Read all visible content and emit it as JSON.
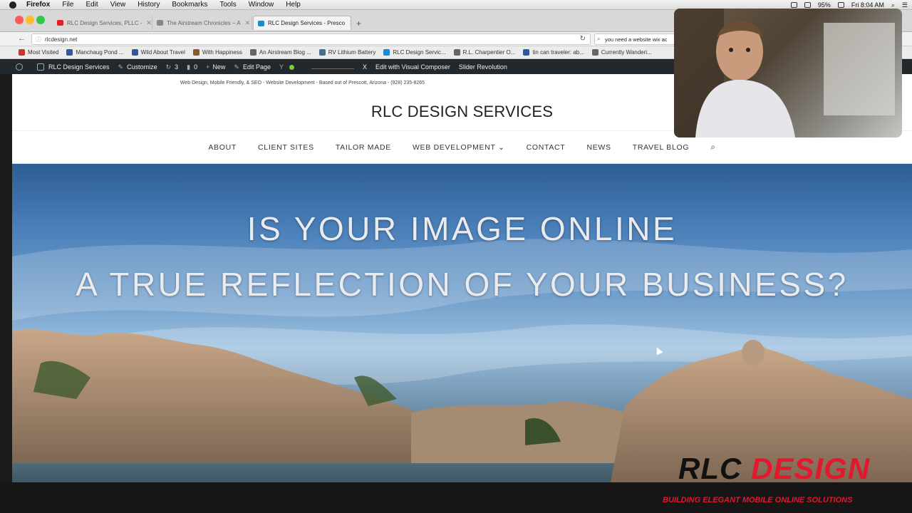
{
  "menubar": {
    "app": "Firefox",
    "items": [
      "File",
      "Edit",
      "View",
      "History",
      "Bookmarks",
      "Tools",
      "Window",
      "Help"
    ],
    "battery": "95%",
    "clock": "Fri 8:04 AM"
  },
  "tabs": [
    {
      "label": "RLC Design Services, PLLC -",
      "color": "#e02020"
    },
    {
      "label": "The Airstream Chronicles – A",
      "color": "#666666"
    },
    {
      "label": "RLC Design Services - Presco",
      "color": "#1a8ad4"
    }
  ],
  "navbar": {
    "url": "rlcdesign.net",
    "search": "you need a website wix ac"
  },
  "bookmarks": [
    {
      "label": "Most Visited",
      "color": "#c0392b"
    },
    {
      "label": "Manchaug Pond ...",
      "color": "#2c5aa0"
    },
    {
      "label": "Wild About Travel",
      "color": "#2c5aa0"
    },
    {
      "label": "With Happiness",
      "color": "#8a5a2b"
    },
    {
      "label": "An Airstream Blog ...",
      "color": "#666666"
    },
    {
      "label": "RV Lithium Battery",
      "color": "#4a6f8a"
    },
    {
      "label": "RLC Design Servic...",
      "color": "#1a8ad4"
    },
    {
      "label": "R.L. Charpentier O...",
      "color": "#666666"
    },
    {
      "label": "tin can traveler: ab...",
      "color": "#2c5aa0"
    },
    {
      "label": "Currently Wanderi...",
      "color": "#666666"
    }
  ],
  "adminbar": {
    "site": "RLC Design Services",
    "customize": "Customize",
    "updates": "3",
    "comments": "0",
    "new": "New",
    "edit": "Edit Page",
    "close": "X",
    "composer": "Edit with Visual Composer",
    "slider": "Slider Revolution"
  },
  "site": {
    "tagline": "Web Design, Mobile Friendly, & SEO - Website Development - Based out of Prescott, Arizona - (928) 235-8265",
    "title": "RLC DESIGN SERVICES",
    "nav": [
      "ABOUT",
      "CLIENT SITES",
      "TAILOR MADE",
      "WEB DEVELOPMENT",
      "CONTACT",
      "NEWS",
      "TRAVEL BLOG"
    ],
    "dropdown_marker": "⌄"
  },
  "hero": {
    "line1": "IS YOUR IMAGE ONLINE",
    "line2": "A TRUE REFLECTION OF YOUR BUSINESS?"
  },
  "logo": {
    "part1": "RLC",
    "part2": "DESIGN",
    "tagline": "BUILDING ELEGANT MOBILE ONLINE SOLUTIONS"
  }
}
